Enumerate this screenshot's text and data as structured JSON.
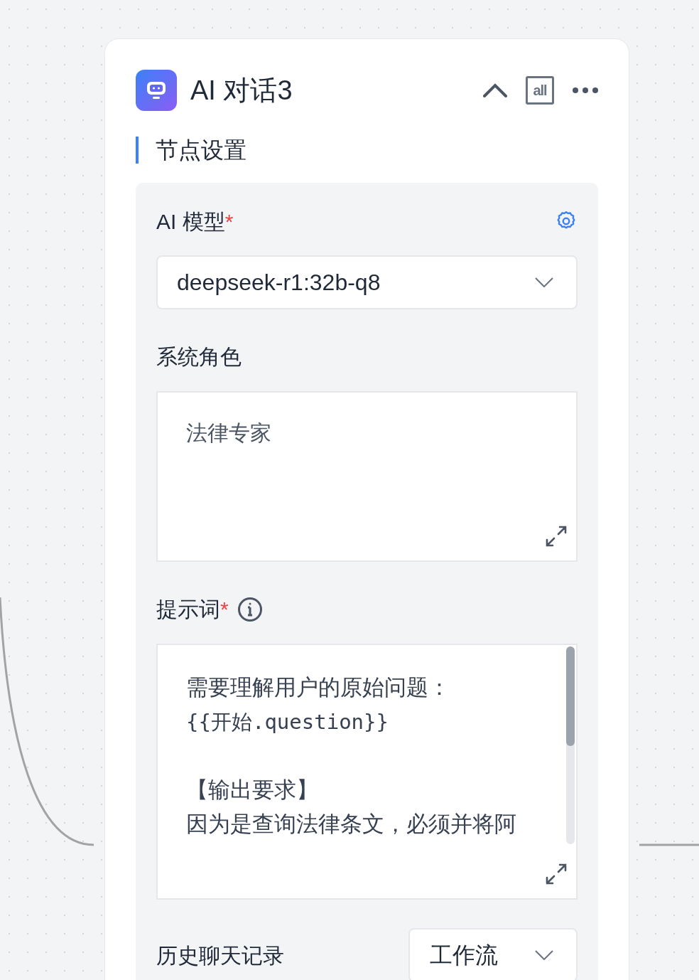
{
  "node": {
    "title": "AI 对话3",
    "collapse_badge": "all"
  },
  "section": {
    "title": "节点设置"
  },
  "model": {
    "label": "AI 模型",
    "required_mark": "*",
    "value": "deepseek-r1:32b-q8"
  },
  "system_role": {
    "label": "系统角色",
    "value": "法律专家"
  },
  "prompt": {
    "label": "提示词",
    "required_mark": "*",
    "paragraphs": [
      [
        {
          "kind": "text",
          "text": "需要理解用户的原始问题："
        },
        {
          "kind": "code",
          "text": "{{开始.question}}"
        }
      ],
      [
        {
          "kind": "text",
          "text": "【输出要求】"
        },
        {
          "kind": "text",
          "text": "因为是查询法律条文，必须并将阿"
        }
      ]
    ]
  },
  "history": {
    "label": "历史聊天记录",
    "value": "工作流"
  }
}
